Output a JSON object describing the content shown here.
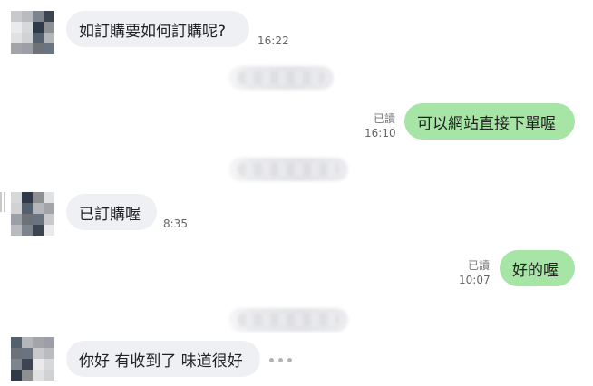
{
  "messages": [
    {
      "id": "m1",
      "side": "incoming",
      "text": "如訂購要如何訂購呢?",
      "time": "16:22"
    },
    {
      "id": "m2",
      "side": "outgoing",
      "text": "可以網站直接下單喔",
      "time": "16:10",
      "read": "已讀"
    },
    {
      "id": "m3",
      "side": "incoming",
      "text": "已訂購喔",
      "time": "8:35"
    },
    {
      "id": "m4",
      "side": "outgoing",
      "text": "好的喔",
      "time": "10:07",
      "read": "已讀"
    },
    {
      "id": "m5",
      "side": "incoming",
      "text": "你好 有收到了 味道很好",
      "time": ""
    }
  ],
  "colors": {
    "incoming_bubble": "#eef0f3",
    "outgoing_bubble": "#a6e5a6",
    "background": "#ffffff"
  },
  "icons": {
    "more": "more-dots-icon"
  }
}
